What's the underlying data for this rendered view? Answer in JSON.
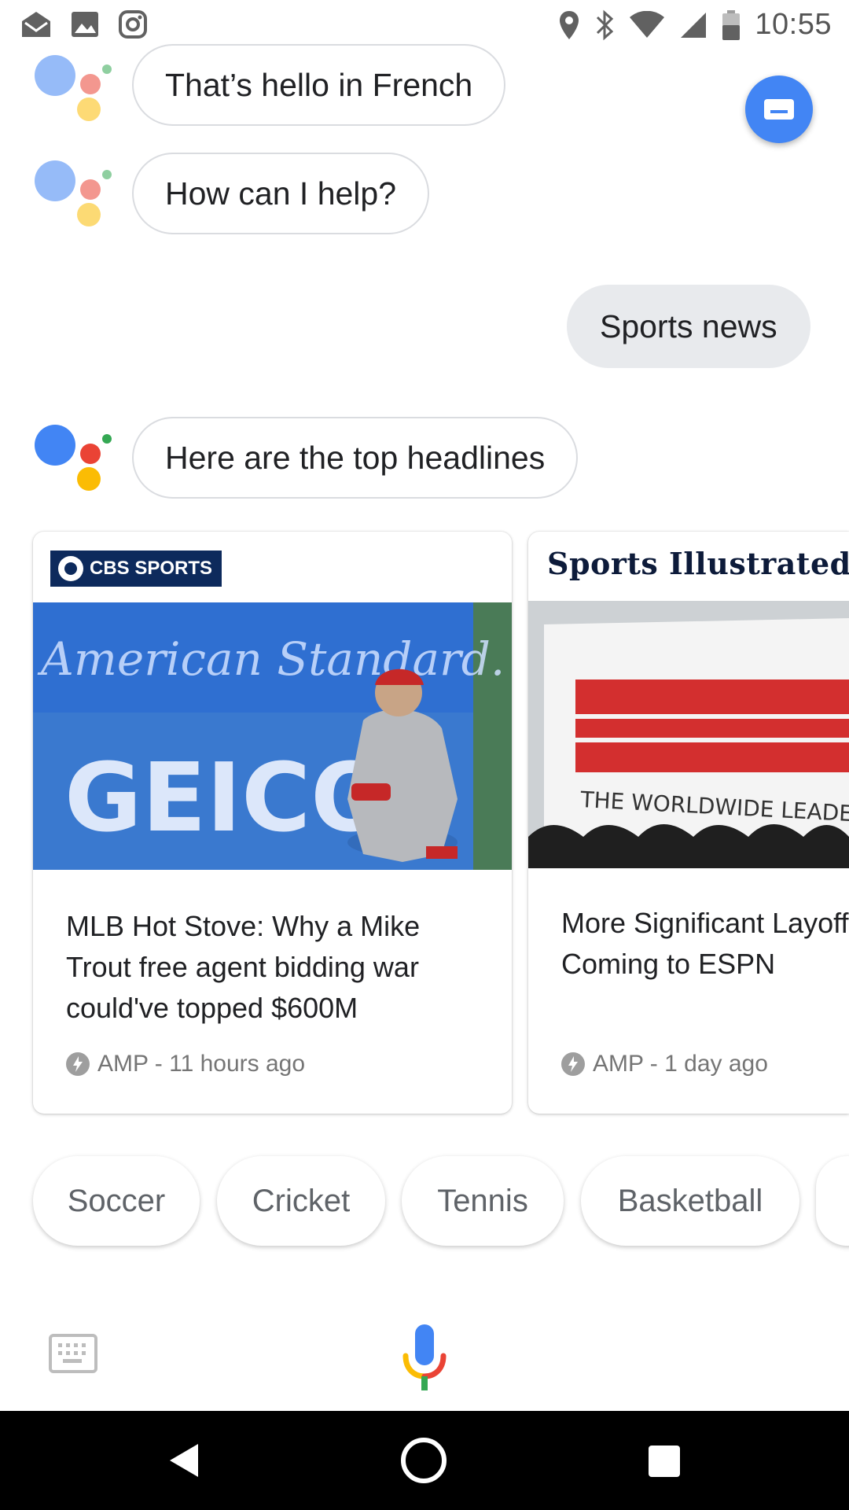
{
  "status_bar": {
    "time": "10:55",
    "left_icons": [
      "mail-icon",
      "image-icon",
      "instagram-icon"
    ],
    "right_icons": [
      "location-icon",
      "bluetooth-icon",
      "wifi-icon",
      "signal-icon",
      "battery-icon"
    ]
  },
  "conversation": {
    "assistant_1": "That’s hello in French",
    "assistant_2": "How can I help?",
    "user_1": "Sports news",
    "assistant_3": "Here are the top headlines"
  },
  "cards": [
    {
      "source": "CBS SPORTS",
      "title": "MLB Hot Stove: Why a Mike Trout free agent bidding war could've topped $600M",
      "meta": "AMP - 11 hours ago"
    },
    {
      "source": "Sports Illustrated",
      "title": "More Significant Layoffs Coming to ESPN",
      "meta": "AMP - 1 day ago"
    }
  ],
  "chips": [
    "Soccer",
    "Cricket",
    "Tennis",
    "Basketball"
  ],
  "colors": {
    "google_blue": "#4285f4",
    "google_red": "#ea4335",
    "google_yellow": "#fbbc04",
    "google_green": "#34a853"
  }
}
